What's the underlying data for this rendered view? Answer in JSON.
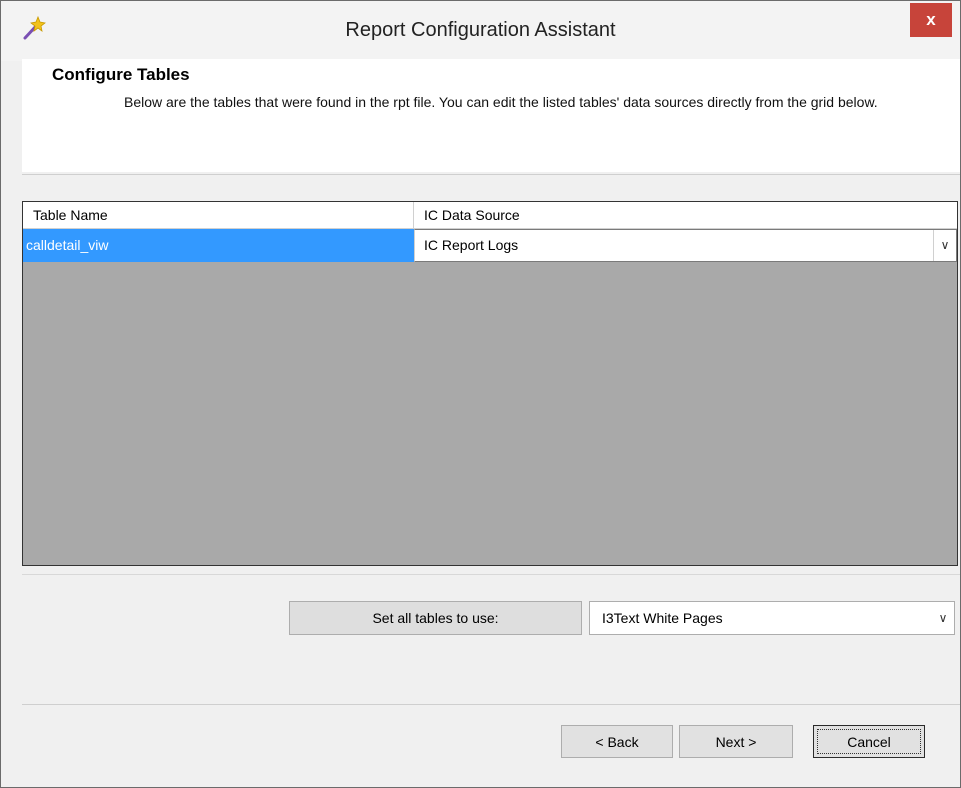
{
  "window": {
    "title": "Report Configuration Assistant",
    "icon": "wand-icon",
    "close_label": "x"
  },
  "header": {
    "title": "Configure Tables",
    "description": "Below are the tables that were found in the rpt file.  You can edit the listed tables' data sources directly from the grid below."
  },
  "grid": {
    "columns": [
      "Table Name",
      "IC Data Source"
    ],
    "rows": [
      {
        "table_name": "calldetail_viw",
        "data_source": "IC Report Logs"
      }
    ]
  },
  "set_all": {
    "button_label": "Set all tables to use:",
    "selected_value": "I3Text White Pages"
  },
  "footer": {
    "back_label": "< Back",
    "next_label": "Next >",
    "cancel_label": "Cancel"
  },
  "colors": {
    "selection": "#3399ff",
    "grid_background": "#a9a9a9",
    "close_button": "#c7443a"
  }
}
